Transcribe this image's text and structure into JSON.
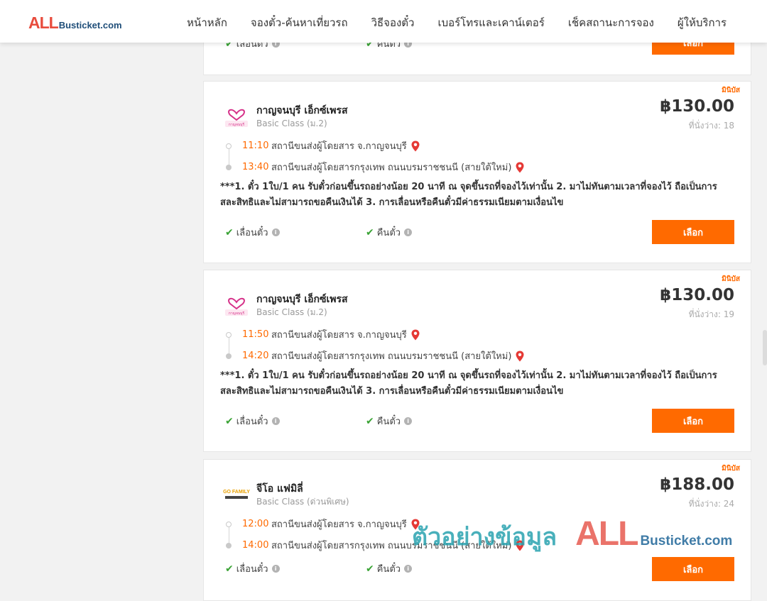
{
  "header": {
    "logo_prefix": "ALL",
    "logo_suffix": "Busticket.com",
    "nav": [
      {
        "label": "หน้าหลัก"
      },
      {
        "label": "จองตั๋ว-ค้นหาเที่ยวรถ"
      },
      {
        "label": "วิธีจองตั๋ว"
      },
      {
        "label": "เบอร์โทรและเคาน์เตอร์"
      },
      {
        "label": "เช็คสถานะการจอง"
      },
      {
        "label": "ผู้ให้บริการ"
      }
    ]
  },
  "partial_top": {
    "feature_1": "เลื่อนตั๋ว",
    "feature_2": "คืนตั๋ว",
    "button": "เลือก"
  },
  "trips": [
    {
      "badge": "มินิบัส",
      "operator": "กาญจนบุรี เอ็กซ์เพรส",
      "class": "Basic Class (ม.2)",
      "price": "฿130.00",
      "seats": "ที่นั่งว่าง: 18",
      "depart_time": "11:10",
      "depart_station": "สถานีขนส่งผู้โดยสาร จ.กาญจนบุรี",
      "arrive_time": "13:40",
      "arrive_station": "สถานีขนส่งผู้โดยสารกรุงเทพ ถนนบรมราชชนนี (สายใต้ใหม่)",
      "note": "***1. ตั๋ว 1ใบ/1 คน รับตั๋วก่อนขึ้นรถอย่างน้อย 20 นาที ณ จุดขึ้นรถที่จองไว้เท่านั้น 2. มาไม่ทันตามเวลาที่จองไว้ ถือเป็นการสละสิทธิและไม่สามารถขอคืนเงินได้ 3. การเลื่อนหรือคืนตั๋วมีค่าธรรมเนียมตามเงื่อนไข",
      "feature_1": "เลื่อนตั๋ว",
      "feature_2": "คืนตั๋ว",
      "button": "เลือก"
    },
    {
      "badge": "มินิบัส",
      "operator": "กาญจนบุรี เอ็กซ์เพรส",
      "class": "Basic Class (ม.2)",
      "price": "฿130.00",
      "seats": "ที่นั่งว่าง: 19",
      "depart_time": "11:50",
      "depart_station": "สถานีขนส่งผู้โดยสาร จ.กาญจนบุรี",
      "arrive_time": "14:20",
      "arrive_station": "สถานีขนส่งผู้โดยสารกรุงเทพ ถนนบรมราชชนนี (สายใต้ใหม่)",
      "note": "***1. ตั๋ว 1ใบ/1 คน รับตั๋วก่อนขึ้นรถอย่างน้อย 20 นาที ณ จุดขึ้นรถที่จองไว้เท่านั้น 2. มาไม่ทันตามเวลาที่จองไว้ ถือเป็นการสละสิทธิและไม่สามารถขอคืนเงินได้ 3. การเลื่อนหรือคืนตั๋วมีค่าธรรมเนียมตามเงื่อนไข",
      "feature_1": "เลื่อนตั๋ว",
      "feature_2": "คืนตั๋ว",
      "button": "เลือก"
    },
    {
      "badge": "มินิบัส",
      "operator": "จีโอ แฟมิลี่",
      "class": "Basic Class (ด่วนพิเศษ)",
      "price": "฿188.00",
      "seats": "ที่นั่งว่าง: 24",
      "depart_time": "12:00",
      "depart_station": "สถานีขนส่งผู้โดยสาร จ.กาญจนบุรี",
      "arrive_time": "14:00",
      "arrive_station": "สถานีขนส่งผู้โดยสารกรุงเทพ ถนนบรมราชชนนี (สายใต้ใหม่)",
      "feature_1": "เลื่อนตั๋ว",
      "feature_2": "คืนตั๋ว",
      "button": "เลือก"
    }
  ],
  "operator_logos": {
    "kanchanaburi_text": "กาญจนบุรี เอ็กซ์เพรส",
    "gofamily_text": "GO FAMILY"
  },
  "watermark": {
    "thai": "ตัวอย่างข้อมูล",
    "prefix": "ALL",
    "suffix": "Busticket.com"
  },
  "colors": {
    "accent": "#ff6a00",
    "check": "#3aa335",
    "logo_red": "#e84c3d",
    "logo_blue": "#1f4e79"
  }
}
